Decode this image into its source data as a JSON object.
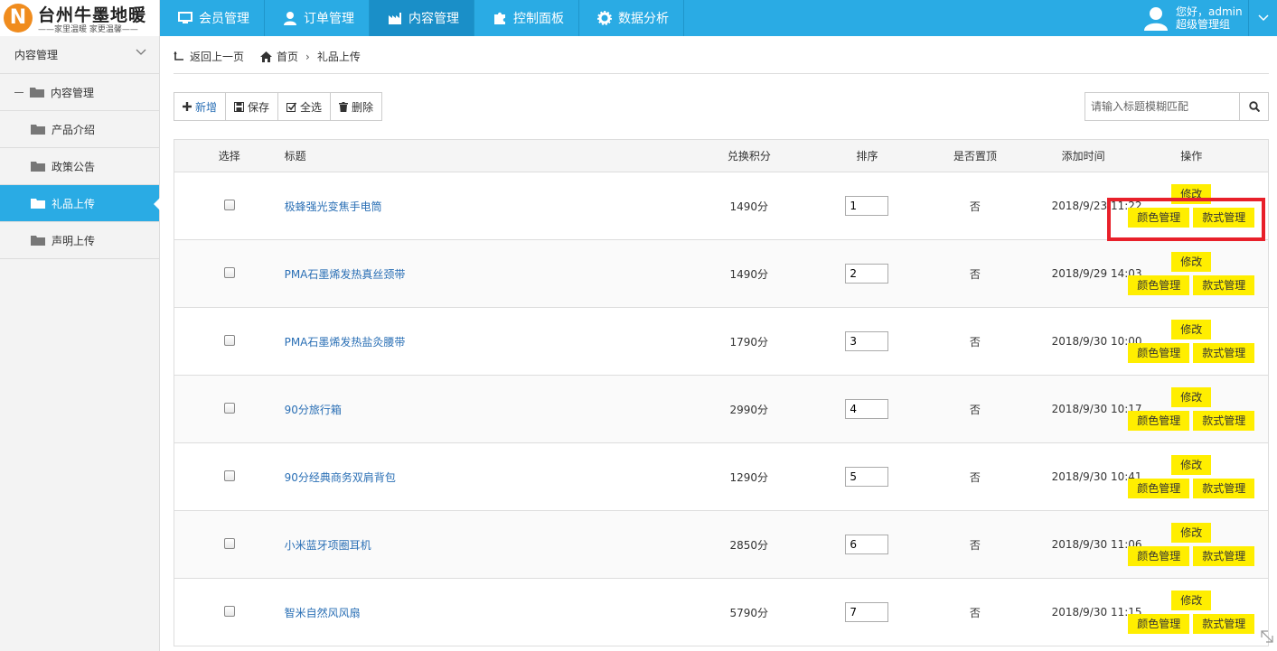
{
  "brand": {
    "mark": "N",
    "title": "台州牛墨地暖",
    "subtitle": "——家里温暖 家更温馨——",
    "color": "#f08c1e"
  },
  "nav": {
    "items": [
      {
        "label": "会员管理",
        "icon": "monitor-icon"
      },
      {
        "label": "订单管理",
        "icon": "user-icon"
      },
      {
        "label": "内容管理",
        "icon": "factory-icon",
        "active": true
      },
      {
        "label": "控制面板",
        "icon": "puzzle-icon"
      },
      {
        "label": "数据分析",
        "icon": "gear-icon"
      }
    ]
  },
  "user": {
    "greeting": "您好，admin",
    "role": "超级管理组"
  },
  "sidebar": {
    "header": "内容管理",
    "items": [
      {
        "label": "内容管理",
        "level": 1
      },
      {
        "label": "产品介绍",
        "level": 2
      },
      {
        "label": "政策公告",
        "level": 2
      },
      {
        "label": "礼品上传",
        "level": 2,
        "active": true
      },
      {
        "label": "声明上传",
        "level": 2
      }
    ]
  },
  "breadcrumb": {
    "back": "返回上一页",
    "home": "首页",
    "current": "礼品上传"
  },
  "toolbar": {
    "add": "新增",
    "save": "保存",
    "select_all": "全选",
    "delete": "删除"
  },
  "search": {
    "placeholder": "请输入标题模糊匹配"
  },
  "table": {
    "headers": {
      "select": "选择",
      "title": "标题",
      "points": "兑换积分",
      "sort": "排序",
      "pinned": "是否置顶",
      "time": "添加时间",
      "ops": "操作"
    },
    "rows": [
      {
        "title": "极蜂强光变焦手电筒",
        "points": "1490分",
        "sort": "1",
        "pinned": "否",
        "time": "2018/9/23 11:22"
      },
      {
        "title": "PMA石墨烯发热真丝颈带",
        "points": "1490分",
        "sort": "2",
        "pinned": "否",
        "time": "2018/9/29 14:03"
      },
      {
        "title": "PMA石墨烯发热盐灸腰带",
        "points": "1790分",
        "sort": "3",
        "pinned": "否",
        "time": "2018/9/30 10:00"
      },
      {
        "title": "90分旅行箱",
        "points": "2990分",
        "sort": "4",
        "pinned": "否",
        "time": "2018/9/30 10:17"
      },
      {
        "title": "90分经典商务双肩背包",
        "points": "1290分",
        "sort": "5",
        "pinned": "否",
        "time": "2018/9/30 10:41"
      },
      {
        "title": "小米蓝牙项圈耳机",
        "points": "2850分",
        "sort": "6",
        "pinned": "否",
        "time": "2018/9/30 11:06"
      },
      {
        "title": "智米自然风风扇",
        "points": "5790分",
        "sort": "7",
        "pinned": "否",
        "time": "2018/9/30 11:15"
      }
    ],
    "ops": {
      "edit": "修改",
      "color": "颜色管理",
      "style": "款式管理"
    }
  },
  "colors": {
    "header_bg": "#2aabe4",
    "active_nav": "#1a8fc8",
    "op_button": "#ffee00",
    "highlight": "#e8202a",
    "link": "#2a6fb5"
  }
}
